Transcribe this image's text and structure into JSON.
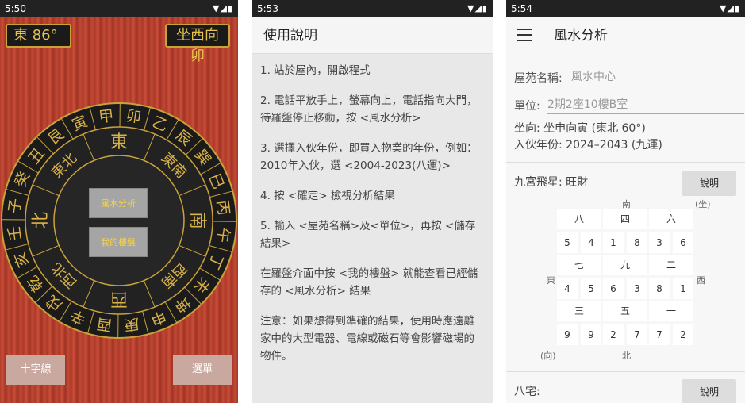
{
  "panel1": {
    "status": {
      "time": "5:50",
      "icons": "▼◢▮"
    },
    "degree_readout": "東 86°",
    "facing_readout": "坐西向卯",
    "outer_ring": [
      "甲",
      "卯",
      "乙",
      "辰",
      "巽",
      "巳",
      "丙",
      "午",
      "丁",
      "未",
      "坤",
      "申",
      "庚",
      "酉",
      "辛",
      "戌",
      "乾",
      "亥",
      "壬",
      "子",
      "癸",
      "丑",
      "艮",
      "寅"
    ],
    "inner_ring": [
      "東",
      "東南",
      "南",
      "西南",
      "西",
      "西北",
      "北",
      "東北"
    ],
    "center_buttons": {
      "fengshui": "風水分析",
      "my_building": "我的樓盤"
    },
    "bottom_buttons": {
      "crosshair": "十字線",
      "menu": "選單"
    }
  },
  "panel2": {
    "status": {
      "time": "5:53",
      "icons": "▼◢▮"
    },
    "title": "使用說明",
    "items": [
      "1. 站於屋內，開啟程式",
      "2. 電話平放手上，螢幕向上，電話指向大門，待羅盤停止移動，按 <風水分析>",
      "3. 選擇入伙年份，即買入物業的年份，例如：2010年入伙，選 <2004-2023(八運)>",
      "4. 按 <確定> 檢視分析結果",
      "5. 輸入 <屋苑名稱>及<單位>，再按 <儲存結果>",
      "在羅盤介面中按 <我的樓盤> 就能查看已經儲存的 <風水分析> 結果",
      "注意：如果想得到準確的結果，使用時應遠離家中的大型電器、電線或磁石等會影響磁場的物件。"
    ]
  },
  "panel3": {
    "status": {
      "time": "5:54",
      "icons": "▼◢▮"
    },
    "title": "風水分析",
    "estate_label": "屋苑名稱:",
    "estate_value": "風水中心",
    "unit_label": "單位:",
    "unit_value": "2期2座10樓B室",
    "facing_line": "坐向: 坐申向寅 (東北 60°)",
    "year_line": "入伙年份: 2024–2043 (九運)",
    "flying_star_line": "九宮飛星: 旺財",
    "explain_button": "說明",
    "directions": {
      "south": "南",
      "north": "北",
      "east": "東",
      "west": "西",
      "sit": "(坐)",
      "face": "(向)"
    },
    "palaces": [
      {
        "name": "八",
        "nums": [
          "5",
          "4"
        ],
        "nums2": [
          "1",
          "8"
        ],
        "nums3": [
          "3",
          "6"
        ]
      },
      {
        "name": "四"
      },
      {
        "name": "六"
      }
    ],
    "grid_names": [
      "八",
      "四",
      "六",
      "七",
      "九",
      "二",
      "三",
      "五",
      "一"
    ],
    "grid_numbers": [
      [
        "5",
        "4"
      ],
      [
        "1",
        "8"
      ],
      [
        "3",
        "6"
      ],
      [
        "4",
        "5"
      ],
      [
        "6",
        "3"
      ],
      [
        "8",
        "1"
      ],
      [
        "9",
        "9"
      ],
      [
        "2",
        "7"
      ],
      [
        "7",
        "2"
      ]
    ],
    "bazhai_label": "八宅:",
    "bazhai_button": "說明"
  }
}
